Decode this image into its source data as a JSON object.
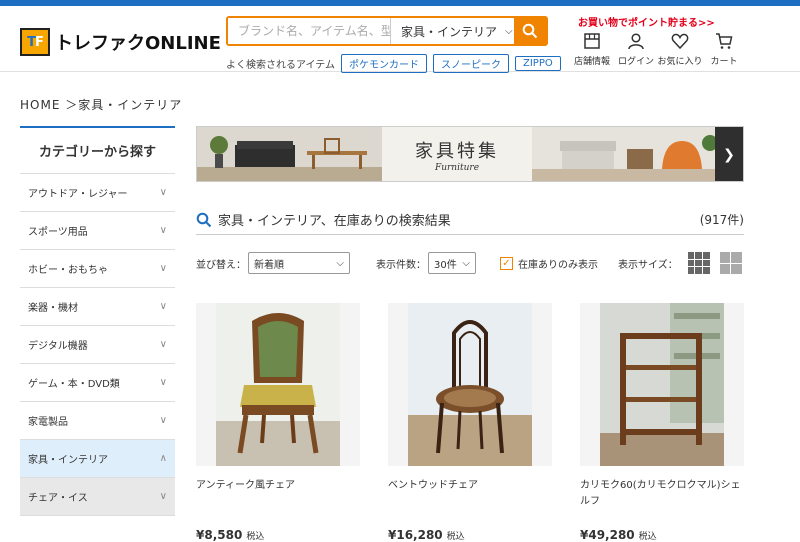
{
  "colors": {
    "accent": "#f08300",
    "brand_blue": "#1e6fc2",
    "promo_red": "#e4001b"
  },
  "header": {
    "logo_text": "トレファクONLINE",
    "search": {
      "placeholder": "ブランド名、アイテム名、型番",
      "category": "家具・インテリア"
    },
    "popular_label": "よく検索されるアイテム",
    "popular_tags": [
      "ポケモンカード",
      "スノーピーク",
      "ZIPPO"
    ],
    "promo": "お買い物でポイント貯まる>>",
    "icons": [
      {
        "icon": "store-icon",
        "label": "店舗情報"
      },
      {
        "icon": "user-icon",
        "label": "ログイン"
      },
      {
        "icon": "heart-icon",
        "label": "お気に入り"
      },
      {
        "icon": "cart-icon",
        "label": "カート"
      }
    ]
  },
  "breadcrumb": {
    "home": "HOME",
    "current": "家具・インテリア"
  },
  "sidebar": {
    "title": "カテゴリーから探す",
    "items": [
      {
        "label": "アウトドア・レジャー",
        "state": "collapsed"
      },
      {
        "label": "スポーツ用品",
        "state": "collapsed"
      },
      {
        "label": "ホビー・おもちゃ",
        "state": "collapsed"
      },
      {
        "label": "楽器・機材",
        "state": "collapsed"
      },
      {
        "label": "デジタル機器",
        "state": "collapsed"
      },
      {
        "label": "ゲーム・本・DVD類",
        "state": "collapsed"
      },
      {
        "label": "家電製品",
        "state": "collapsed"
      },
      {
        "label": "家具・インテリア",
        "state": "expanded"
      },
      {
        "label": "チェア・イス",
        "state": "sub"
      }
    ]
  },
  "banner": {
    "title": "家具特集",
    "subtitle": "Furniture"
  },
  "results": {
    "title": "家具・インテリア、在庫ありの検索結果",
    "count": "(917件)"
  },
  "controls": {
    "sort_label": "並び替え：",
    "sort_value": "新着順",
    "per_page_label": "表示件数：",
    "per_page_value": "30件",
    "in_stock_label": "在庫ありのみ表示",
    "in_stock_checked": true,
    "size_label": "表示サイズ："
  },
  "products": [
    {
      "name": "アンティーク風チェア",
      "price": "¥8,580",
      "tax": "税込"
    },
    {
      "name": "ベントウッドチェア",
      "price": "¥16,280",
      "tax": "税込"
    },
    {
      "name": "カリモク60(カリモクロクマル)シェルフ",
      "price": "¥49,280",
      "tax": "税込"
    }
  ]
}
